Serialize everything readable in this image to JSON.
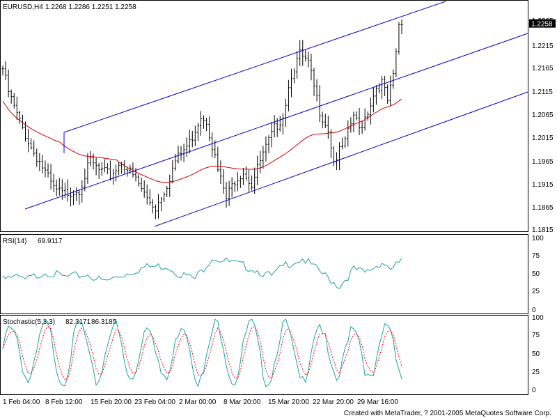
{
  "symbol": "EURUSD,H4",
  "ohlc_text": "1.2268 1.2286 1.2251 1.2258",
  "last_price": "1.2258",
  "footer": "Created with MetaTrader, ? 2001-2005 MetaQuotes Software Corp.",
  "colors": {
    "price": "#000000",
    "ma": "#cc0000",
    "channel": "#0000cc",
    "rsi": "#20a0a0",
    "stoch_main": "#20a0a0",
    "stoch_signal": "#ff0000",
    "price_tag_bg": "#000000",
    "price_tag_text": "#ffffff"
  },
  "main": {
    "price_ticks": [
      "1.2265",
      "1.2215",
      "1.2165",
      "1.2115",
      "1.2065",
      "1.2015",
      "1.1965",
      "1.1915",
      "1.1865",
      "1.1815"
    ],
    "last": 1.2258
  },
  "rsi": {
    "label": "RSI(14)",
    "value": "69.9117",
    "ticks": [
      "100",
      "75",
      "50",
      "25",
      "0"
    ]
  },
  "stochastic": {
    "label": "Stochastic(5,3,3)",
    "value_main": "82.3171",
    "value_signal": "86.3185",
    "ticks": [
      "100",
      "75",
      "50",
      "25",
      "0"
    ]
  },
  "time_labels": [
    "1 Feb 04:00",
    "8 Feb 12:00",
    "15 Feb 20:00",
    "23 Feb 04:00",
    "2 Mar 00:00",
    "8 Mar 20:00",
    "15 Mar 20:00",
    "22 Mar 20:00",
    "29 Mar 16:00"
  ],
  "chart_data": [
    {
      "type": "line",
      "title": "EURUSD,H4",
      "series": [
        {
          "name": "EURUSD,H4",
          "x": [
            "1 Feb 04:00",
            "8 Feb 12:00",
            "15 Feb 20:00",
            "23 Feb 04:00",
            "2 Mar 00:00",
            "8 Mar 20:00",
            "15 Mar 20:00",
            "22 Mar 20:00",
            "29 Mar 16:00"
          ],
          "values": [
            1.214,
            1.192,
            1.196,
            1.186,
            1.193,
            1.192,
            1.218,
            1.199,
            1.21
          ]
        }
      ],
      "ylim": [
        1.1815,
        1.229
      ],
      "last_value": 1.2258,
      "annotations": [
        "blue upward regression channel",
        "red moving average"
      ]
    },
    {
      "type": "line",
      "title": "RSI(14) 69.9117",
      "series": [
        {
          "name": "RSI(14)",
          "values": [
            48,
            42,
            55,
            48,
            60,
            45,
            70,
            55,
            58,
            45,
            75,
            42,
            65,
            70
          ]
        }
      ],
      "ylim": [
        0,
        100
      ],
      "last_value": 69.9117
    },
    {
      "type": "line",
      "title": "Stochastic(5,3,3) 82.3171 86.3185",
      "series": [
        {
          "name": "Stochastic(5,3,3)",
          "values": [
            80,
            30,
            85,
            20,
            90,
            15,
            80,
            20,
            85,
            30,
            92,
            25,
            88,
            15,
            85
          ]
        },
        {
          "name": "Signal",
          "values": [
            85,
            35,
            80,
            25,
            85,
            20,
            75,
            25,
            80,
            35,
            88,
            30,
            85,
            20,
            86
          ]
        }
      ],
      "ylim": [
        0,
        100
      ],
      "last_value": 82.3171
    }
  ]
}
